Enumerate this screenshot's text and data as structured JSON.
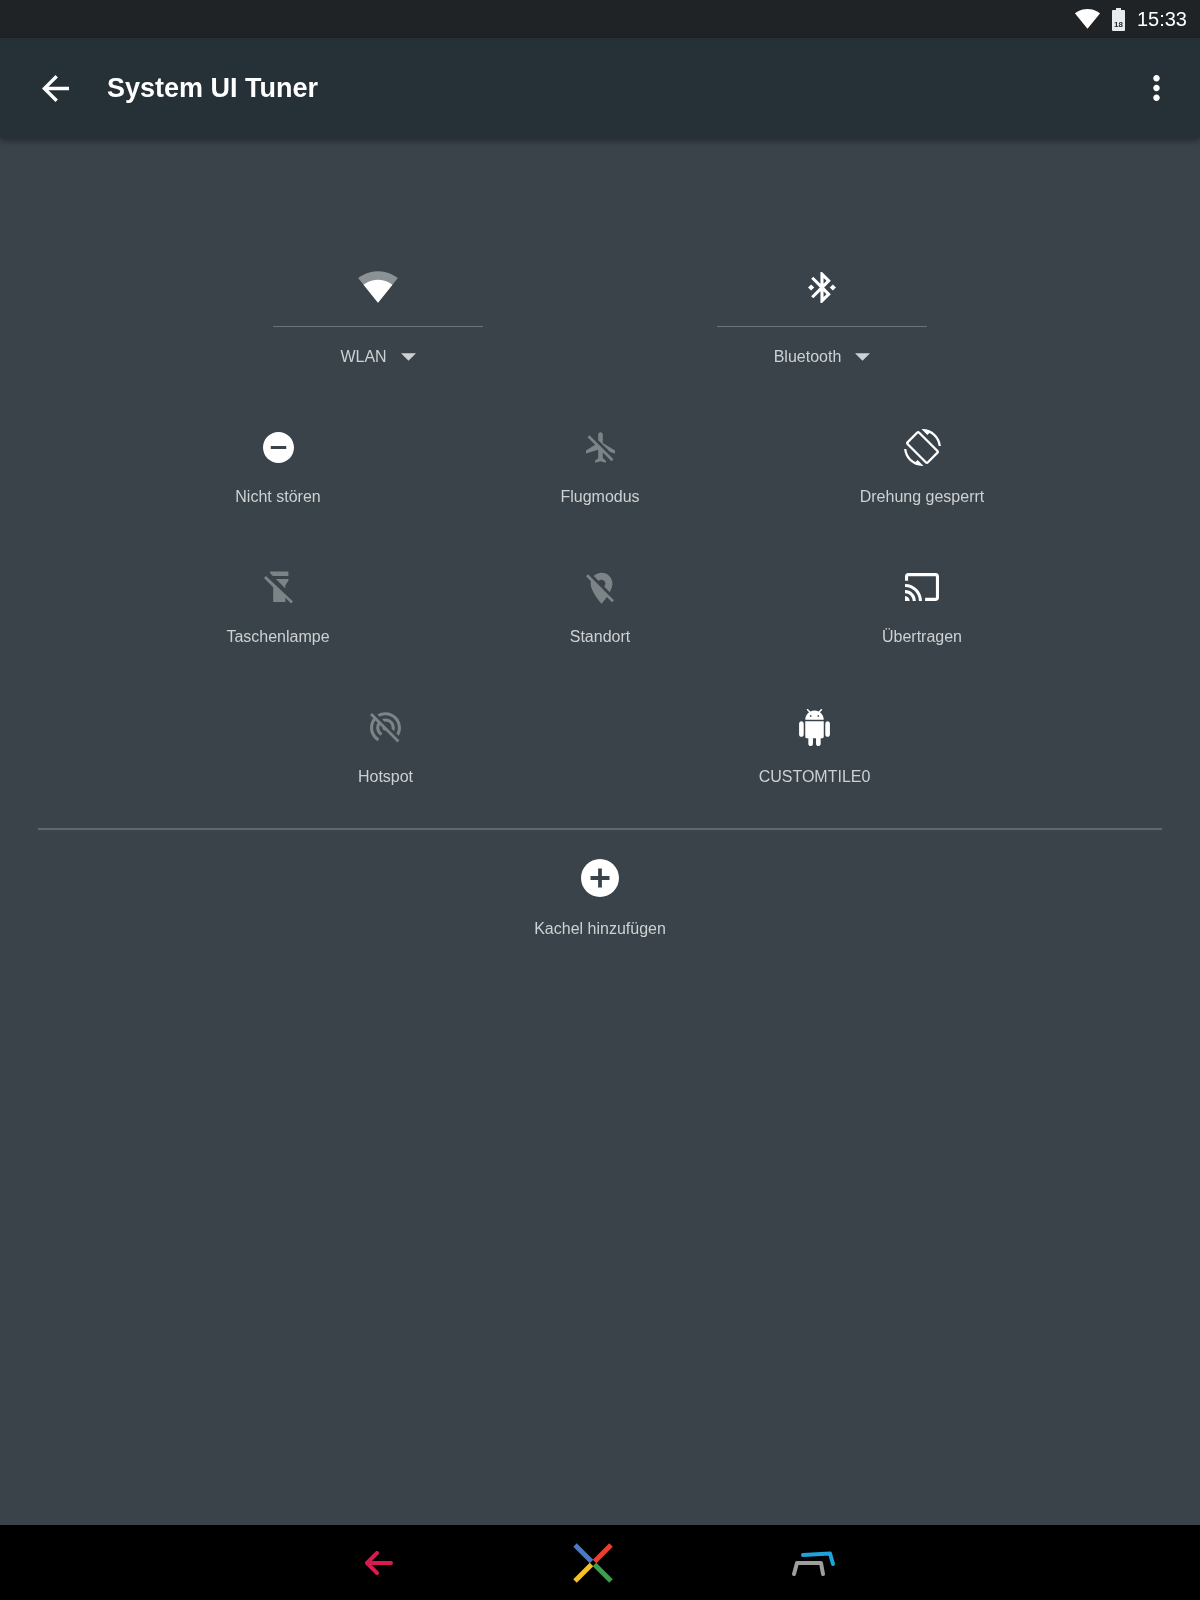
{
  "status_bar": {
    "battery_text": "18",
    "time": "15:33"
  },
  "toolbar": {
    "title": "System UI Tuner"
  },
  "tile_rows": [
    {
      "tiles": [
        {
          "kind": "dual",
          "label": "WLAN",
          "on": true
        },
        {
          "kind": "dual",
          "label": "Bluetooth",
          "on": true
        }
      ]
    },
    {
      "tiles": [
        {
          "kind": "single",
          "label": "Nicht stören",
          "on": true
        },
        {
          "kind": "single",
          "label": "Flugmodus",
          "on": false
        },
        {
          "kind": "single",
          "label": "Drehung gesperrt",
          "on": true
        }
      ]
    },
    {
      "tiles": [
        {
          "kind": "single",
          "label": "Taschenlampe",
          "on": false
        },
        {
          "kind": "single",
          "label": "Standort",
          "on": false
        },
        {
          "kind": "single",
          "label": "Übertragen",
          "on": true
        }
      ]
    },
    {
      "tiles": [
        {
          "kind": "single",
          "label": "Hotspot",
          "on": false
        },
        {
          "kind": "single",
          "label": "CUSTOMTILE0",
          "on": true
        }
      ]
    }
  ],
  "add_tile": {
    "label": "Kachel hinzufügen"
  }
}
